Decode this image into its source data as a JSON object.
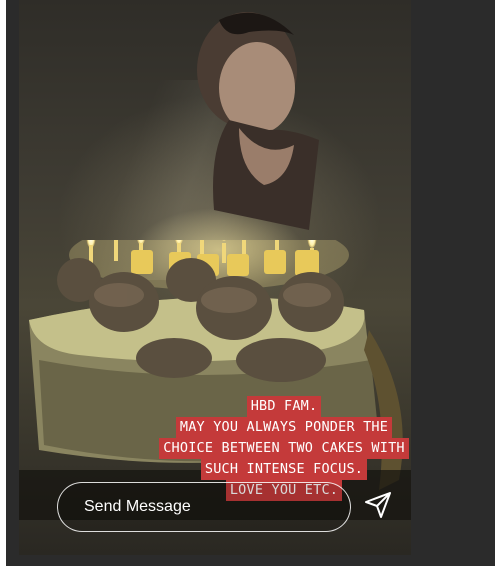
{
  "story": {
    "caption_lines": [
      "HBD FAM.",
      "MAY YOU ALWAYS PONDER THE",
      "CHOICE BETWEEN TWO CAKES WITH",
      "SUCH INTENSE FOCUS.",
      "LOVE YOU ETC."
    ],
    "caption_bg_color": "#c43a3a"
  },
  "reply": {
    "placeholder": "Send Message",
    "send_icon": "paper-plane-icon"
  }
}
